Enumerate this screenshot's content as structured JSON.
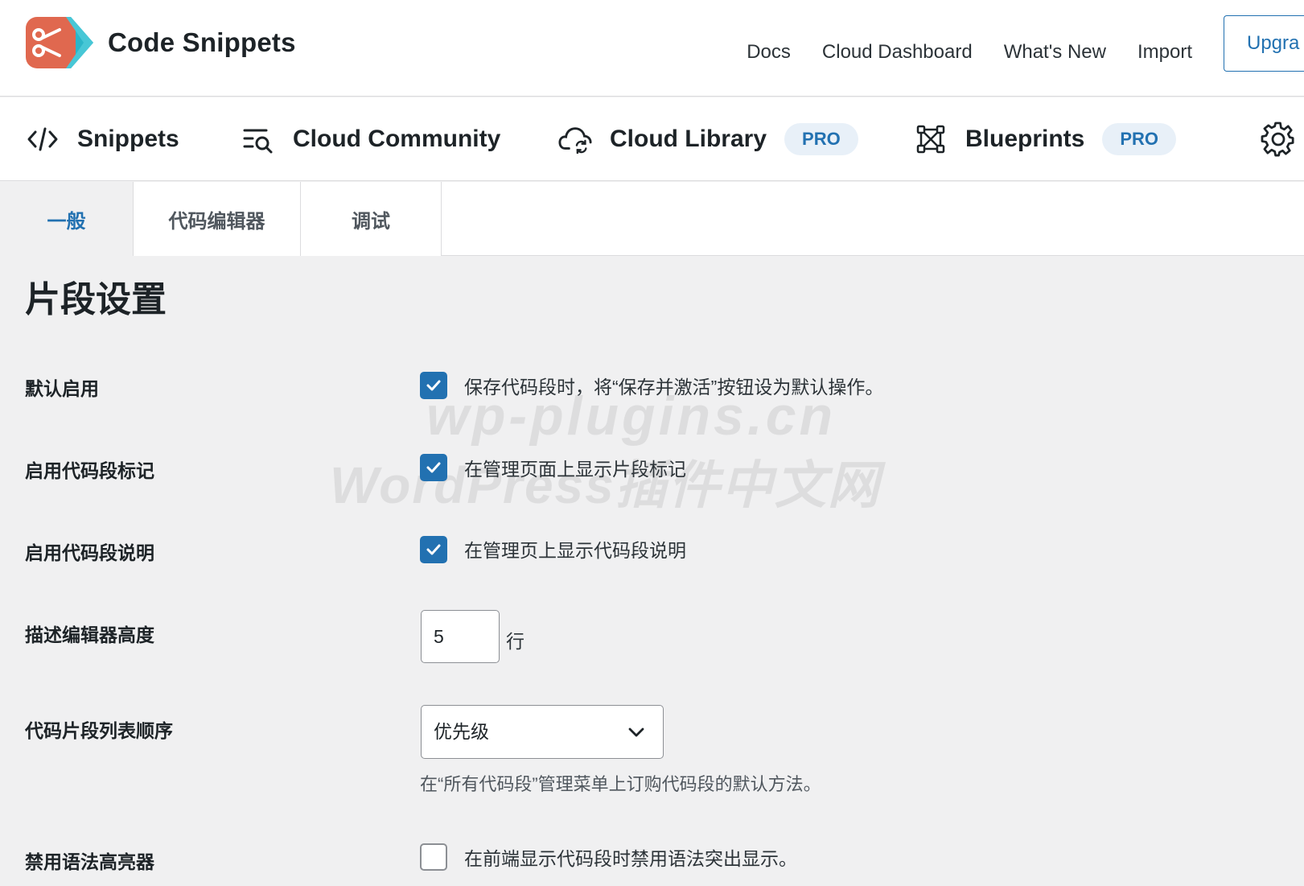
{
  "header": {
    "brand_name": "Code Snippets",
    "links": [
      "Docs",
      "Cloud Dashboard",
      "What's New",
      "Import"
    ],
    "upgrade_label": "Upgra"
  },
  "nav": {
    "items": [
      {
        "label": "Snippets",
        "icon": "code-icon"
      },
      {
        "label": "Cloud Community",
        "icon": "search-list-icon"
      },
      {
        "label": "Cloud Library",
        "icon": "cloud-sync-icon",
        "badge": "PRO"
      },
      {
        "label": "Blueprints",
        "icon": "blueprint-icon",
        "badge": "PRO"
      }
    ]
  },
  "tabs": [
    "一般",
    "代码编辑器",
    "调试"
  ],
  "page_title": "片段设置",
  "settings": {
    "activate_by_default": {
      "label": "默认启用",
      "text": "保存代码段时，将“保存并激活”按钮设为默认操作。",
      "checked": true
    },
    "enable_tags": {
      "label": "启用代码段标记",
      "text": "在管理页面上显示片段标记",
      "checked": true
    },
    "enable_description": {
      "label": "启用代码段说明",
      "text": "在管理页上显示代码段说明",
      "checked": true
    },
    "description_height": {
      "label": "描述编辑器高度",
      "value": "5",
      "suffix": "行"
    },
    "list_order": {
      "label": "代码片段列表顺序",
      "selected": "优先级",
      "help": "在“所有代码段”管理菜单上订购代码段的默认方法。"
    },
    "disable_highlighter": {
      "label": "禁用语法高亮器",
      "text": "在前端显示代码段时禁用语法突出显示。",
      "checked": false
    }
  },
  "watermark": {
    "line1": "wp-plugins.cn",
    "line2": "WordPress插件中文网"
  },
  "colors": {
    "accent": "#2271b1",
    "logo_orange": "#e0684f",
    "logo_teal": "#2bb5c8"
  }
}
